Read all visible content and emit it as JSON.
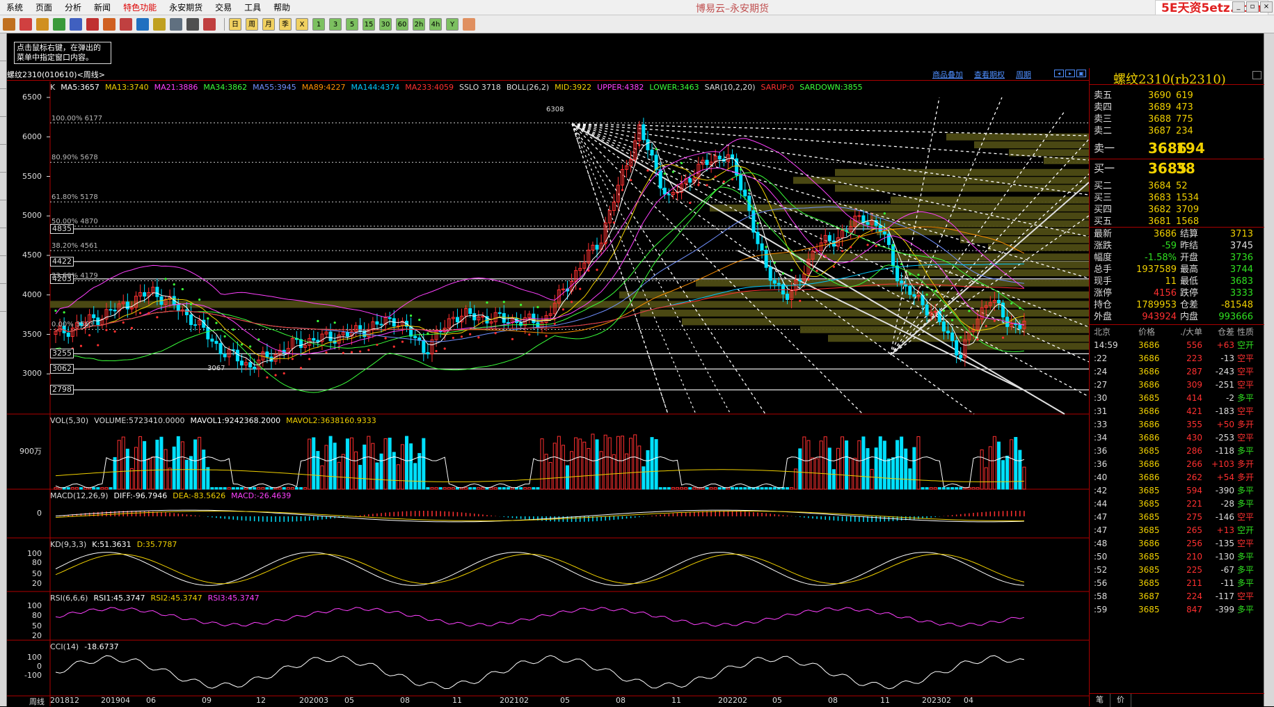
{
  "menu": {
    "items": [
      "系统",
      "页面",
      "分析",
      "新闻",
      "特色功能",
      "永安期货",
      "交易",
      "工具",
      "帮助"
    ],
    "highlight_index": 4
  },
  "app_title": "博易云–永安期货",
  "watermark": "5E天资5etz.com",
  "toolbar": {
    "icons": [
      "home-icon",
      "book-icon",
      "list-icon",
      "refresh-icon",
      "search-icon",
      "zoom-icon",
      "chart-icon",
      "pen-icon",
      "tool-icon",
      "lamp-icon",
      "grid-icon",
      "calc-icon",
      "candle-icon",
      "day-icon",
      "week-icon",
      "month-icon",
      "season-icon",
      "year-icon",
      "m1-icon",
      "m3-icon",
      "m5-icon",
      "m15-icon",
      "m30-icon",
      "m60-icon",
      "m120-icon",
      "m240-icon",
      "y-icon",
      "window-icon"
    ],
    "period_labels": [
      "日",
      "周",
      "月",
      "季",
      "X",
      "1",
      "3",
      "5",
      "15",
      "30",
      "60",
      "2h",
      "4h",
      "Y"
    ]
  },
  "tooltip": {
    "line1": "点击鼠标右键，在弹出的",
    "line2": "菜单中指定窗口内容。"
  },
  "chart_header": {
    "symbol": "螺纹2310(010610)<周线>",
    "links": [
      "商品叠加",
      "查看期权",
      "周期"
    ]
  },
  "main_legend": [
    {
      "text": "K",
      "color": "#dddddd"
    },
    {
      "text": "MA5:3657",
      "color": "#ffffff"
    },
    {
      "text": "MA13:3740",
      "color": "#f0d000"
    },
    {
      "text": "MA21:3886",
      "color": "#ff40ff"
    },
    {
      "text": "MA34:3862",
      "color": "#3aff3a"
    },
    {
      "text": "MA55:3945",
      "color": "#7090ff"
    },
    {
      "text": "MA89:4227",
      "color": "#ff9000"
    },
    {
      "text": "MA144:4374",
      "color": "#00c8ff"
    },
    {
      "text": "MA233:4059",
      "color": "#ff3030"
    },
    {
      "text": "SSLO 3718",
      "color": "#dddddd"
    },
    {
      "text": "BOLL(26,2)",
      "color": "#dddddd"
    },
    {
      "text": "MID:3922",
      "color": "#f0d000"
    },
    {
      "text": "UPPER:4382",
      "color": "#ff40ff"
    },
    {
      "text": "LOWER:3463",
      "color": "#3aff3a"
    },
    {
      "text": "SAR(10,2,20)",
      "color": "#dddddd"
    },
    {
      "text": "SARUP:0",
      "color": "#ff3030"
    },
    {
      "text": "SARDOWN:3855",
      "color": "#3aff3a"
    }
  ],
  "main_yticks": [
    "6500",
    "6000",
    "5500",
    "5000",
    "4500",
    "4000",
    "3500",
    "3000"
  ],
  "level_boxes": [
    "4835",
    "4422",
    "4203",
    "3255",
    "3062",
    "2798"
  ],
  "fib_labels": [
    "100.00% 6177",
    "80.90% 5678",
    "61.80% 5178",
    "50.00% 4870",
    "38.20% 4561",
    "23.60% 4179",
    "0.00% 3563"
  ],
  "peak_label": "6308",
  "trough_label": "3067",
  "vol_legend": [
    {
      "text": "VOL(5,30)",
      "color": "#dddddd"
    },
    {
      "text": "VOLUME:5723410.0000",
      "color": "#dddddd"
    },
    {
      "text": "MAVOL1:9242368.2000",
      "color": "#ffffff"
    },
    {
      "text": "MAVOL2:3638160.9333",
      "color": "#f0d000"
    }
  ],
  "vol_ytick": "900万",
  "macd_legend": [
    {
      "text": "MACD(12,26,9)",
      "color": "#dddddd"
    },
    {
      "text": "DIFF:-96.7946",
      "color": "#ffffff"
    },
    {
      "text": "DEA:-83.5626",
      "color": "#f0d000"
    },
    {
      "text": "MACD:-26.4639",
      "color": "#ff40ff"
    }
  ],
  "macd_ytick": "0",
  "kd_legend": [
    {
      "text": "KD(9,3,3)",
      "color": "#dddddd"
    },
    {
      "text": "K:51.3631",
      "color": "#ffffff"
    },
    {
      "text": "D:35.7787",
      "color": "#f0d000"
    }
  ],
  "kd_yticks": [
    "100",
    "80",
    "50",
    "20"
  ],
  "rsi_legend": [
    {
      "text": "RSI(6,6,6)",
      "color": "#dddddd"
    },
    {
      "text": "RSI1:45.3747",
      "color": "#ffffff"
    },
    {
      "text": "RSI2:45.3747",
      "color": "#f0d000"
    },
    {
      "text": "RSI3:45.3747",
      "color": "#ff40ff"
    }
  ],
  "rsi_yticks": [
    "100",
    "80",
    "50",
    "20"
  ],
  "cci_legend": [
    {
      "text": "CCI(14)",
      "color": "#dddddd"
    },
    {
      "text": "-18.6737",
      "color": "#ffffff"
    }
  ],
  "cci_yticks": [
    "100",
    "0",
    "-100"
  ],
  "x_axis_prefix": "周线",
  "x_ticks": [
    "201812",
    "201904",
    "06",
    "09",
    "12",
    "202003",
    "05",
    "08",
    "11",
    "202102",
    "05",
    "08",
    "11",
    "202202",
    "05",
    "08",
    "11",
    "202302",
    "04"
  ],
  "quote": {
    "title": "螺纹2310(rb2310)",
    "asks": [
      {
        "label": "卖五",
        "price": "3690",
        "vol": "619"
      },
      {
        "label": "卖四",
        "price": "3689",
        "vol": "473"
      },
      {
        "label": "卖三",
        "price": "3688",
        "vol": "775"
      },
      {
        "label": "卖二",
        "price": "3687",
        "vol": "234"
      },
      {
        "label": "卖一",
        "price": "3686",
        "vol": "194"
      }
    ],
    "bids": [
      {
        "label": "买一",
        "price": "3685",
        "vol": "38"
      },
      {
        "label": "买二",
        "price": "3684",
        "vol": "52"
      },
      {
        "label": "买三",
        "price": "3683",
        "vol": "1534"
      },
      {
        "label": "买四",
        "price": "3682",
        "vol": "3709"
      },
      {
        "label": "买五",
        "price": "3681",
        "vol": "1568"
      }
    ],
    "stats": [
      {
        "l1": "最新",
        "v1": "3686",
        "c1": "yl",
        "l2": "结算",
        "v2": "3713",
        "c2": "yl"
      },
      {
        "l1": "涨跌",
        "v1": "-59",
        "c1": "dn",
        "l2": "昨结",
        "v2": "3745",
        "c2": "wh"
      },
      {
        "l1": "幅度",
        "v1": "-1.58%",
        "c1": "dn",
        "l2": "开盘",
        "v2": "3736",
        "c2": "dn"
      },
      {
        "l1": "总手",
        "v1": "1937589",
        "c1": "yl",
        "l2": "最高",
        "v2": "3744",
        "c2": "dn"
      },
      {
        "l1": "现手",
        "v1": "11",
        "c1": "yl",
        "l2": "最低",
        "v2": "3683",
        "c2": "dn"
      },
      {
        "l1": "涨停",
        "v1": "4156",
        "c1": "up",
        "l2": "跌停",
        "v2": "3333",
        "c2": "dn"
      },
      {
        "l1": "持仓",
        "v1": "1789953",
        "c1": "yl",
        "l2": "仓差",
        "v2": "-81548",
        "c2": "yl"
      },
      {
        "l1": "外盘",
        "v1": "943924",
        "c1": "up",
        "l2": "内盘",
        "v2": "993666",
        "c2": "dn"
      }
    ],
    "tick_header": {
      "place": "北京",
      "price": "价格",
      "size": "./大单",
      "oi": "仓差",
      "nature": "性质"
    },
    "ticks": [
      {
        "t": "14:59",
        "p": "3686",
        "v": "556",
        "c": "+63",
        "n": "空开",
        "cc": "up",
        "nc": "dn"
      },
      {
        "t": ":22",
        "p": "3686",
        "v": "223",
        "c": "-13",
        "n": "空平",
        "cc": "wh",
        "nc": "up"
      },
      {
        "t": ":24",
        "p": "3686",
        "v": "287",
        "c": "-243",
        "n": "空平",
        "cc": "wh",
        "nc": "up"
      },
      {
        "t": ":27",
        "p": "3686",
        "v": "309",
        "c": "-251",
        "n": "空平",
        "cc": "wh",
        "nc": "up"
      },
      {
        "t": ":30",
        "p": "3685",
        "v": "414",
        "c": "-2",
        "n": "多平",
        "cc": "wh",
        "nc": "dn"
      },
      {
        "t": ":31",
        "p": "3686",
        "v": "421",
        "c": "-183",
        "n": "空平",
        "cc": "wh",
        "nc": "up"
      },
      {
        "t": ":33",
        "p": "3686",
        "v": "355",
        "c": "+50",
        "n": "多开",
        "cc": "up",
        "nc": "up"
      },
      {
        "t": ":34",
        "p": "3686",
        "v": "430",
        "c": "-253",
        "n": "空平",
        "cc": "wh",
        "nc": "up"
      },
      {
        "t": ":36",
        "p": "3685",
        "v": "286",
        "c": "-118",
        "n": "多平",
        "cc": "wh",
        "nc": "dn"
      },
      {
        "t": ":36",
        "p": "3686",
        "v": "266",
        "c": "+103",
        "n": "多开",
        "cc": "up",
        "nc": "up"
      },
      {
        "t": ":40",
        "p": "3686",
        "v": "262",
        "c": "+54",
        "n": "多开",
        "cc": "up",
        "nc": "up"
      },
      {
        "t": ":42",
        "p": "3685",
        "v": "594",
        "c": "-390",
        "n": "多平",
        "cc": "wh",
        "nc": "dn"
      },
      {
        "t": ":44",
        "p": "3685",
        "v": "221",
        "c": "-28",
        "n": "多平",
        "cc": "wh",
        "nc": "dn"
      },
      {
        "t": ":47",
        "p": "3685",
        "v": "275",
        "c": "-146",
        "n": "空平",
        "cc": "wh",
        "nc": "up"
      },
      {
        "t": ":47",
        "p": "3685",
        "v": "265",
        "c": "+13",
        "n": "空开",
        "cc": "up",
        "nc": "dn"
      },
      {
        "t": ":48",
        "p": "3686",
        "v": "256",
        "c": "-135",
        "n": "空平",
        "cc": "wh",
        "nc": "up"
      },
      {
        "t": ":50",
        "p": "3685",
        "v": "210",
        "c": "-130",
        "n": "多平",
        "cc": "wh",
        "nc": "dn"
      },
      {
        "t": ":52",
        "p": "3685",
        "v": "225",
        "c": "-67",
        "n": "多平",
        "cc": "wh",
        "nc": "dn"
      },
      {
        "t": ":56",
        "p": "3685",
        "v": "211",
        "c": "-11",
        "n": "多平",
        "cc": "wh",
        "nc": "dn"
      },
      {
        "t": ":58",
        "p": "3687",
        "v": "224",
        "c": "-117",
        "n": "空平",
        "cc": "wh",
        "nc": "up"
      },
      {
        "t": ":59",
        "p": "3685",
        "v": "847",
        "c": "-399",
        "n": "多平",
        "cc": "wh",
        "nc": "dn"
      }
    ],
    "bottom_tabs": [
      "笔",
      "价"
    ]
  }
}
